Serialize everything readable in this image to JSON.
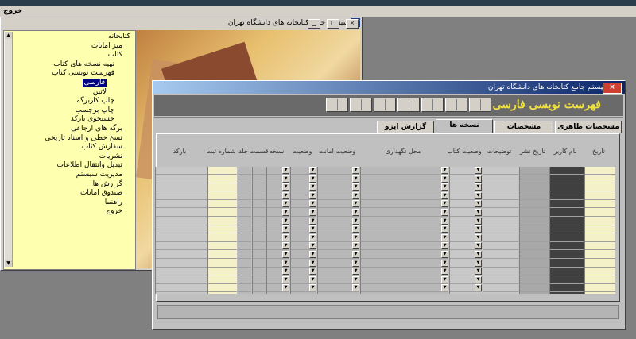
{
  "menubar": {
    "exit_label": "خروج"
  },
  "back_window": {
    "title": "سیستم جامع کتابخانه های دانشگاه تهران",
    "title_icon": "ut-logo-icon",
    "tree": [
      {
        "label": "کتابخانه",
        "depth": 0
      },
      {
        "label": "میز امانات",
        "depth": 1
      },
      {
        "label": "کتاب",
        "depth": 1
      },
      {
        "label": "تهیه نسخه های کتاب",
        "depth": 2
      },
      {
        "label": "فهرست نویسی کتاب",
        "depth": 2
      },
      {
        "label": "فارسی",
        "depth": 3,
        "selected": true
      },
      {
        "label": "لاتین",
        "depth": 3
      },
      {
        "label": "چاپ کاربرگه",
        "depth": 2
      },
      {
        "label": "چاپ برچسب",
        "depth": 2
      },
      {
        "label": "جستجوی بارکد",
        "depth": 2
      },
      {
        "label": "برگه های ارجاعی",
        "depth": 1
      },
      {
        "label": "نسخ خطی و اسناد تاریخی",
        "depth": 1
      },
      {
        "label": "سفارش کتاب",
        "depth": 1
      },
      {
        "label": "نشریات",
        "depth": 1
      },
      {
        "label": "تبدیل وانتقال اطلاعات",
        "depth": 1
      },
      {
        "label": "مدیریت سیستم",
        "depth": 1
      },
      {
        "label": "گزارش ها",
        "depth": 1
      },
      {
        "label": "صندوق امانات",
        "depth": 1
      },
      {
        "label": "راهنما",
        "depth": 1
      },
      {
        "label": "خروج",
        "depth": 1
      }
    ]
  },
  "front_window": {
    "title": "سیستم جامع کتابخانه های دانشگاه تهران",
    "close_label": "×",
    "header": "فهرست نویسی فارسی",
    "tabs": [
      {
        "label": "مشخصات ظاهری",
        "active": false
      },
      {
        "label": "مشخصات تفصیلی",
        "active": false
      },
      {
        "label": "نسخه ها",
        "active": true
      },
      {
        "label": "گزارش ایزو",
        "active": false
      }
    ],
    "columns": [
      {
        "label": "تاریخ",
        "dropdown": false
      },
      {
        "label": "نام کاربر",
        "dropdown": false
      },
      {
        "label": "تاریخ نشر",
        "dropdown": false
      },
      {
        "label": "توضیحات",
        "dropdown": false
      },
      {
        "label": "وضعیت کتاب",
        "dropdown": true
      },
      {
        "label": "محل نگهداری",
        "dropdown": true
      },
      {
        "label": "وضعیت امانت",
        "dropdown": true
      },
      {
        "label": "وضعیت",
        "dropdown": true
      },
      {
        "label": "نسخه",
        "dropdown": true
      },
      {
        "label": "قسمت",
        "dropdown": false
      },
      {
        "label": "جلد",
        "dropdown": false
      },
      {
        "label": "شماره ثبت",
        "dropdown": false
      },
      {
        "label": "بارکد",
        "dropdown": false
      }
    ],
    "row_count": 15
  }
}
